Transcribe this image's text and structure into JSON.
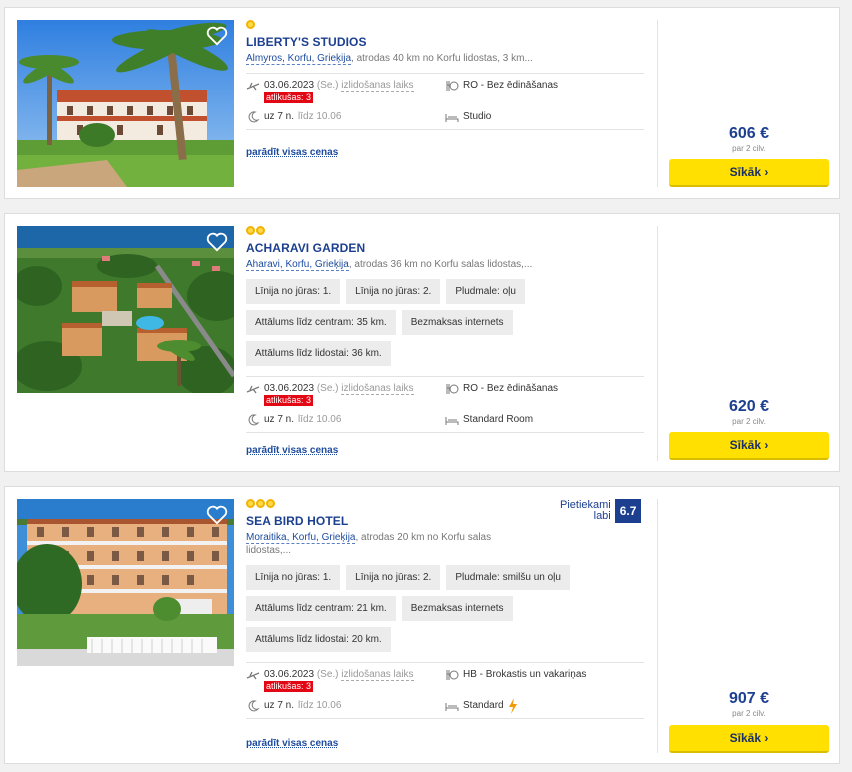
{
  "hotels": [
    {
      "name": "LIBERTY'S STUDIOS",
      "stars": 1,
      "location_link": "Almyros, Korfu, Grieķija",
      "location_rest": ", atrodas 40 km no Korfu lidostas, 3 km...",
      "tags": [],
      "date": "03.06.2023",
      "day": "(Se.)",
      "departure_label": "izlidošanas laiks",
      "left_badge": "atlikušas: 3",
      "nights": "uz 7 n.",
      "until": "līdz 10.06",
      "board": "RO - Bez ēdināšanas",
      "room": "Studio",
      "show_prices": "parādīt visas cenas",
      "price": "606 €",
      "per": "par 2 cilv.",
      "button": "Sīkāk ›"
    },
    {
      "name": "ACHARAVI GARDEN",
      "stars": 2,
      "location_link": "Aharavi, Korfu, Grieķija",
      "location_rest": ", atrodas 36 km no Korfu salas lidostas,...",
      "tags": [
        "Līnija no jūras: 1.",
        "Līnija no jūras: 2.",
        "Pludmale: oļu",
        "Attālums līdz centram: 35 km.",
        "Bezmaksas internets",
        "Attālums līdz lidostai: 36 km."
      ],
      "date": "03.06.2023",
      "day": "(Se.)",
      "departure_label": "izlidošanas laiks",
      "left_badge": "atlikušas: 3",
      "nights": "uz 7 n.",
      "until": "līdz 10.06",
      "board": "RO - Bez ēdināšanas",
      "room": "Standard Room",
      "show_prices": "parādīt visas cenas",
      "price": "620 €",
      "per": "par 2 cilv.",
      "button": "Sīkāk ›"
    },
    {
      "name": "SEA BIRD HOTEL",
      "stars": 3,
      "location_link": "Moraitika, Korfu, Grieķija",
      "location_rest": ", atrodas 20 km no Korfu salas lidostas,...",
      "tags": [
        "Līnija no jūras: 1.",
        "Līnija no jūras: 2.",
        "Pludmale: smilšu un oļu",
        "Attālums līdz centram: 21 km.",
        "Bezmaksas internets",
        "Attālums līdz lidostai: 20 km."
      ],
      "rating_text_1": "Pietiekami",
      "rating_text_2": "labi",
      "rating_value": "6.7",
      "date": "03.06.2023",
      "day": "(Se.)",
      "departure_label": "izlidošanas laiks",
      "left_badge": "atlikušas: 3",
      "nights": "uz 7 n.",
      "until": "līdz 10.06",
      "board": "HB - Brokastis un vakariņas",
      "room": "Standard",
      "show_prices": "parādīt visas cenas",
      "price": "907 €",
      "per": "par 2 cilv.",
      "button": "Sīkāk ›"
    }
  ],
  "colors": {
    "accent": "#1c3f8f",
    "button": "#ffe000",
    "badge": "#e30613",
    "star": "#f1b400"
  }
}
